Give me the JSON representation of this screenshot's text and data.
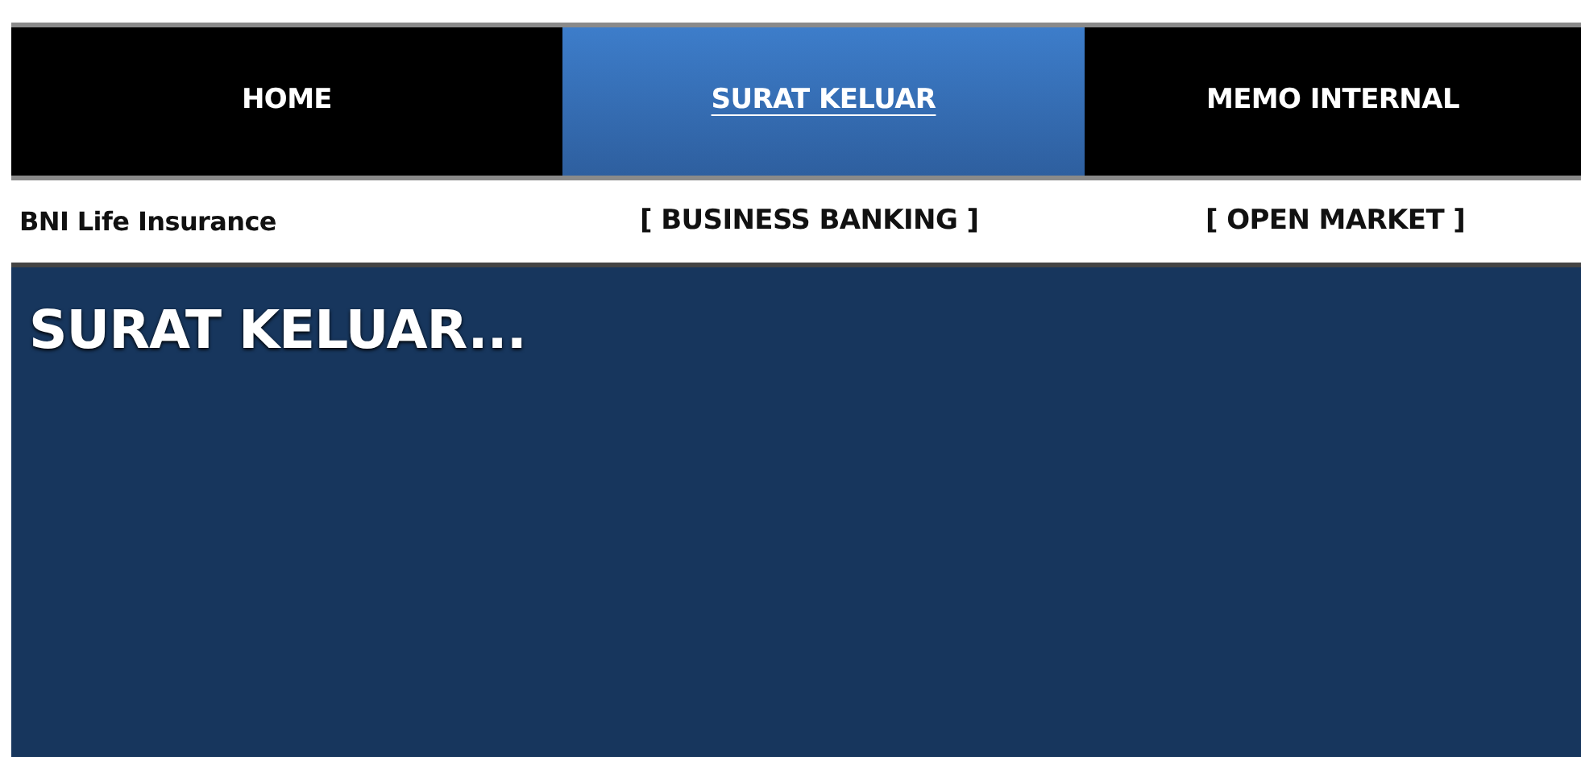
{
  "tabs": [
    {
      "label": "HOME",
      "selected": false
    },
    {
      "label": "SURAT KELUAR",
      "selected": true
    },
    {
      "label": "MEMO INTERNAL",
      "selected": false
    }
  ],
  "subnav": [
    {
      "label": "BNI Life Insurance",
      "kind": "brand"
    },
    {
      "label": "[ BUSINESS BANKING ]",
      "kind": "link"
    },
    {
      "label": "[ OPEN MARKET ]",
      "kind": "link"
    }
  ],
  "panel": {
    "title": "SURAT KELUAR..."
  }
}
